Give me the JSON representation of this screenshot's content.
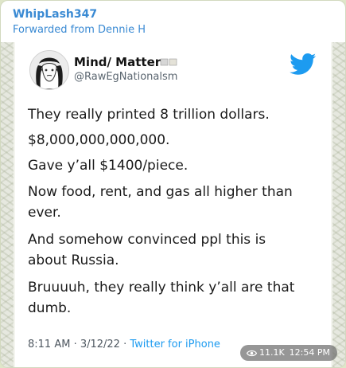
{
  "message": {
    "sender": "WhipLash347",
    "forwarded_from": "Forwarded from Dennie H",
    "views": "11.1K",
    "time": "12:54 PM",
    "view_icon": "eye-icon"
  },
  "tweet": {
    "display_name": "Mind/ Matter",
    "handle": "@RawEgNationalsm",
    "logo": "twitter-bird-icon",
    "lines": [
      "They really printed 8 trillion dollars.",
      "$8,000,000,000,000.",
      "Gave y’all $1400/piece.",
      "Now food, rent, and gas all higher than",
      "ever.",
      "And somehow convinced ppl this is",
      "about Russia.",
      "Bruuuuh, they really think y’all are that",
      "dumb."
    ],
    "timestamp": "8:11 AM · 3/12/22 · ",
    "source": "Twitter for iPhone",
    "accent_color": "#1d9bf0"
  },
  "colors": {
    "sender": "#3a8ad3",
    "chat_background": "#dfe6c9",
    "twitter_blue": "#1d9bf0"
  }
}
